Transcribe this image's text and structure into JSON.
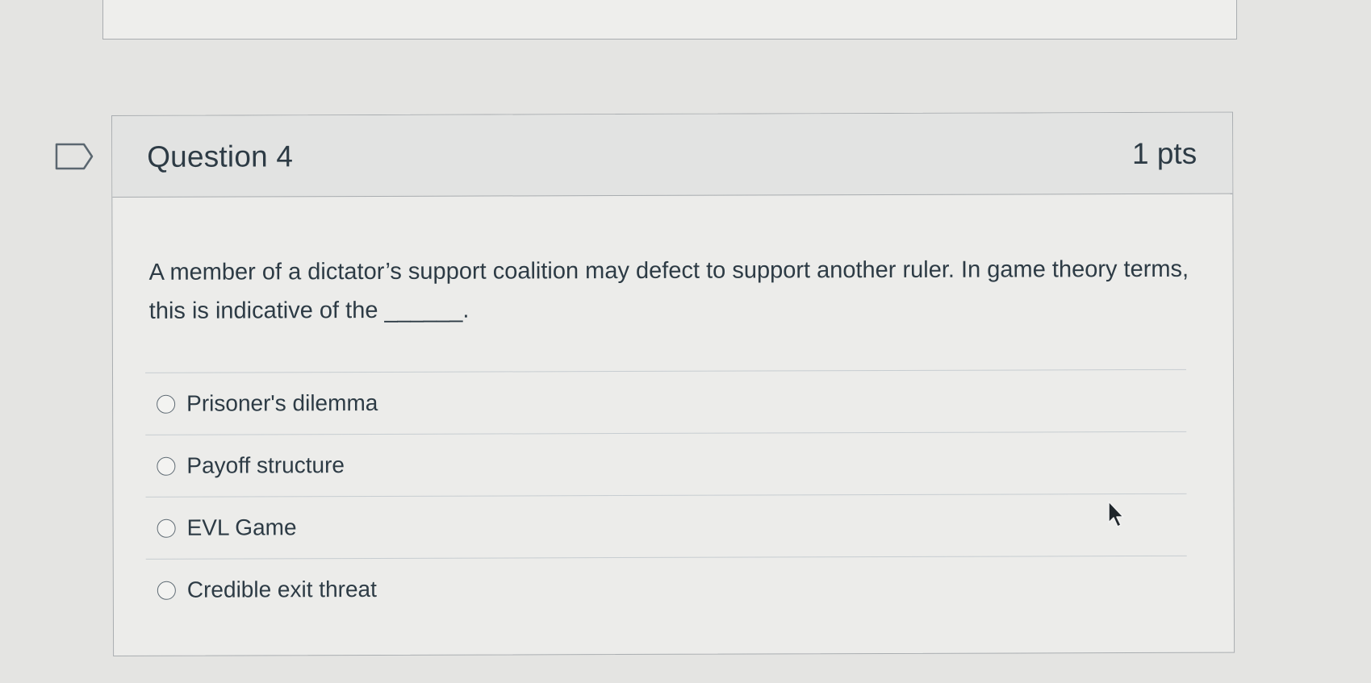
{
  "question": {
    "title": "Question 4",
    "points": "1 pts",
    "text": "A member of a dictator’s support coalition may defect to support another ruler. In game theory terms, this is indicative of the ______.",
    "answers": [
      {
        "label": "Prisoner's dilemma",
        "selected": false
      },
      {
        "label": "Payoff structure",
        "selected": false
      },
      {
        "label": "EVL Game",
        "selected": false
      },
      {
        "label": "Credible exit threat",
        "selected": false
      }
    ]
  },
  "icons": {
    "flag": "flag-question-icon",
    "cursor": "mouse-pointer-icon"
  },
  "colors": {
    "text": "#2d3b45",
    "border": "#a9adb0",
    "header_bg": "#e2e3e2"
  }
}
